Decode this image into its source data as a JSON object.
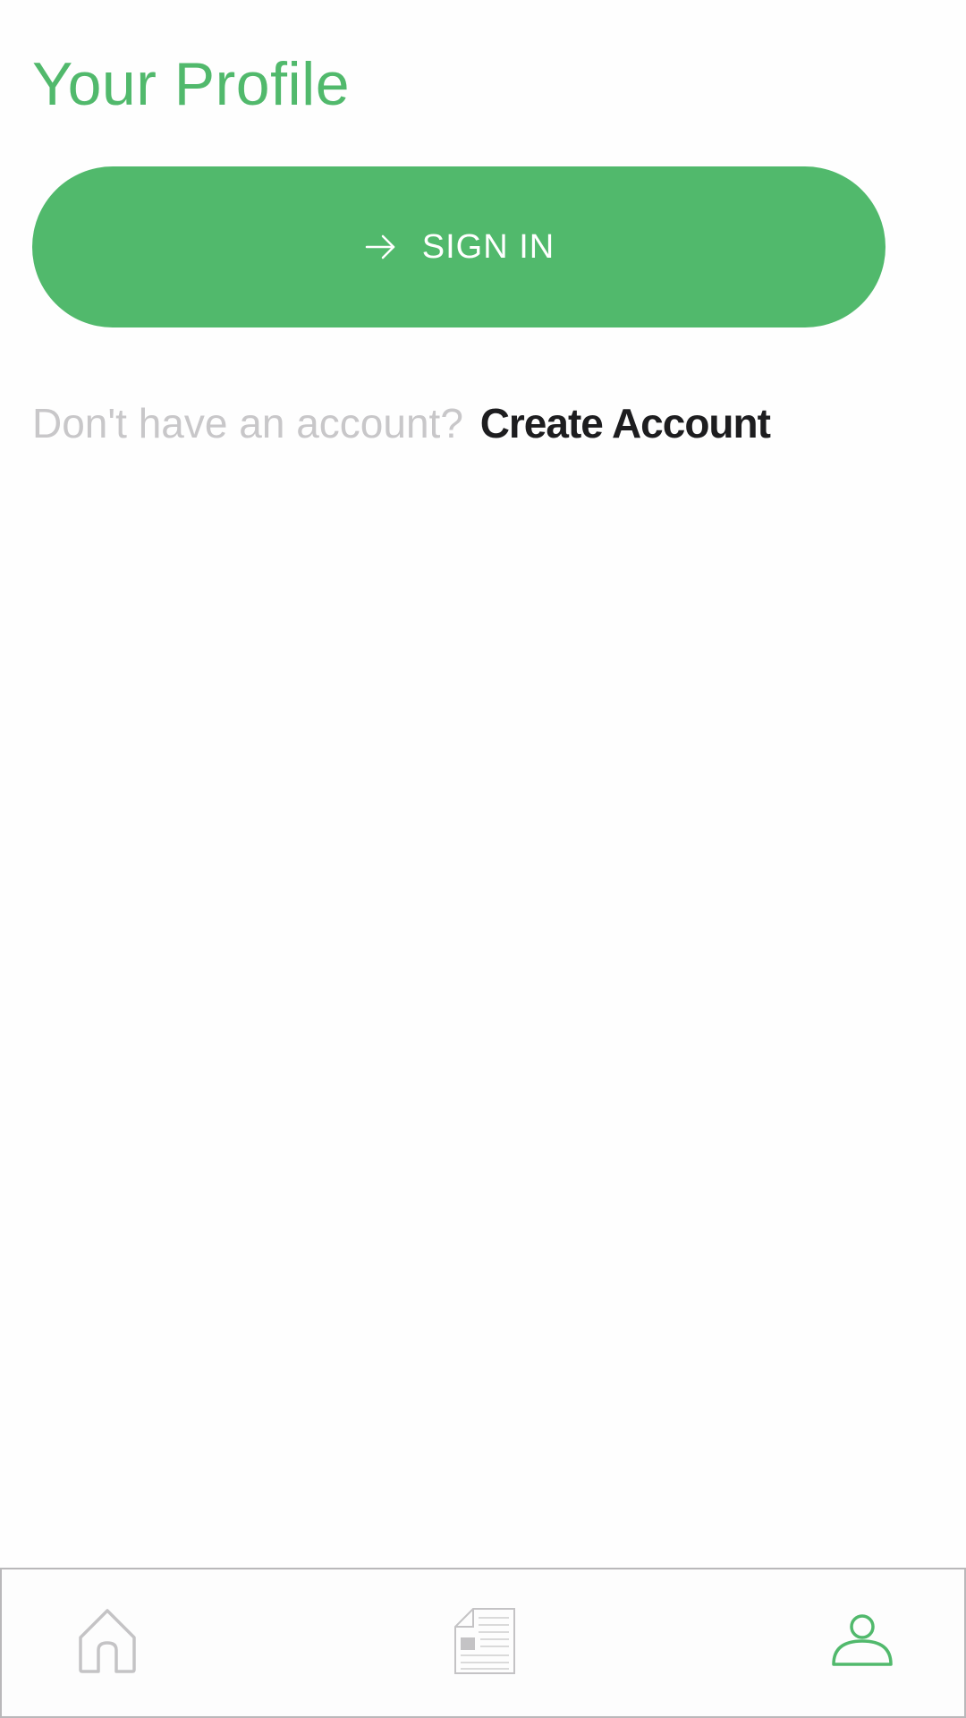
{
  "header": {
    "title": "Your Profile"
  },
  "auth": {
    "sign_in_label": "SIGN IN",
    "sign_in_icon": "arrow-right-icon",
    "account_prompt": "Don't have an account?",
    "create_account_label": "Create Account"
  },
  "bottom_nav": {
    "items": [
      {
        "icon": "home-icon",
        "active": false
      },
      {
        "icon": "newspaper-icon",
        "active": false
      },
      {
        "icon": "user-icon",
        "active": true
      }
    ]
  },
  "colors": {
    "accent": "#51b96c",
    "muted_text": "#c8c7c9",
    "strong_text": "#1d1d1f",
    "inactive_icon": "#c4c3c5",
    "nav_border": "#b9b8ba"
  }
}
